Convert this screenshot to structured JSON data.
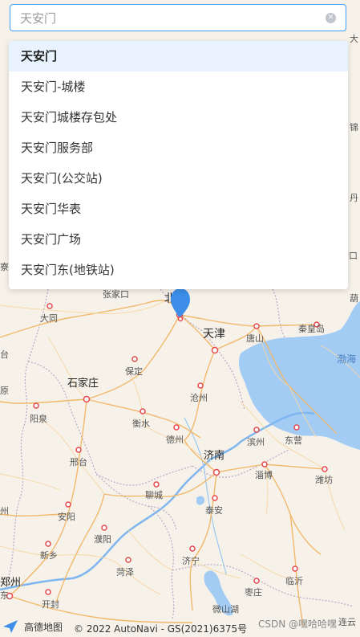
{
  "search": {
    "value": "天安门",
    "placeholder": "天安门"
  },
  "suggestions": [
    {
      "label": "天安门"
    },
    {
      "label": "天安门-城楼"
    },
    {
      "label": "天安门城楼存包处"
    },
    {
      "label": "天安门服务部"
    },
    {
      "label": "天安门(公交站)"
    },
    {
      "label": "天安门华表"
    },
    {
      "label": "天安门广场"
    },
    {
      "label": "天安门东(地铁站)"
    }
  ],
  "map": {
    "cities": {
      "zhangjiakou": "张家口",
      "beijing": "北京",
      "datong": "大同",
      "tianjin": "天津",
      "tangshan": "唐山",
      "qinhuangdao": "秦皇岛",
      "baoding": "保定",
      "shijiazhuang": "石家庄",
      "cangzhou": "沧州",
      "hengshui": "衡水",
      "yangquan": "阳泉",
      "dezhou": "德州",
      "binzhou": "滨州",
      "dongying": "东营",
      "xingtai": "邢台",
      "jinan": "济南",
      "zibo": "淄博",
      "weifang": "潍坊",
      "liaocheng": "聊城",
      "taian": "泰安",
      "anyang": "安阳",
      "puyang": "濮阳",
      "heze": "菏泽",
      "jining": "济宁",
      "linyi": "临沂",
      "zaozhuang": "枣庄",
      "xinxiang": "新乡",
      "zhengzhou": "郑州",
      "kaifeng": "开封",
      "weishanhu": "微山湖",
      "lianyungang": "连云"
    },
    "water": {
      "bohai": "渤海"
    },
    "edge_fragments": {
      "left1": "寮",
      "left2": "台",
      "left3": "州",
      "left4": "原",
      "left5": "东",
      "right1": "葫",
      "right2": "大",
      "right3": "锦",
      "right4": "丹",
      "right5": "营口"
    }
  },
  "footer": {
    "logo_text": "高德地图",
    "copyright": "© 2022 AutoNavi - GS(2021)6375号",
    "watermark": "CSDN @嘿哈哈嘿"
  },
  "colors": {
    "accent": "#409eff",
    "marker": "#3c8ee8",
    "water": "#a3ccf5",
    "land": "#f6f2ea",
    "road": "#f2b86b",
    "border": "#b9a9c6"
  },
  "icons": {
    "clear": "close-circle-icon",
    "marker": "location-pin-icon",
    "logo": "gaode-logo-icon"
  }
}
